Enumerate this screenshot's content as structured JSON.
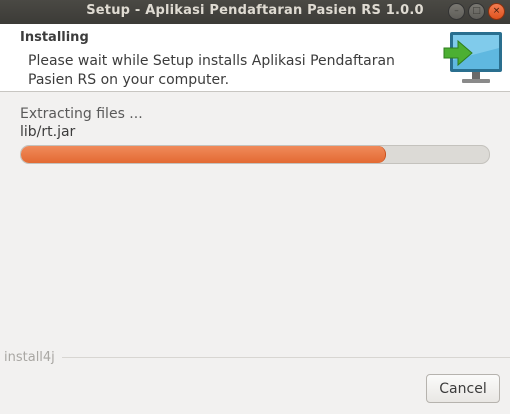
{
  "window": {
    "title": "Setup - Aplikasi Pendaftaran Pasien RS 1.0.0",
    "controls": {
      "minimize": "–",
      "maximize": "□",
      "close": "×"
    }
  },
  "header": {
    "title": "Installing",
    "description": "Please wait while Setup installs Aplikasi Pendaftaran Pasien RS on your computer.",
    "icon": "monitor-install-icon"
  },
  "progress": {
    "status": "Extracting files ...",
    "current_file": "lib/rt.jar",
    "value": 0.78
  },
  "footer": {
    "brand": "install4j",
    "cancel_label": "Cancel"
  },
  "colors": {
    "progress_fill": "#e8743f",
    "titlebar": "#3c3b37",
    "close_button": "#e95420"
  }
}
